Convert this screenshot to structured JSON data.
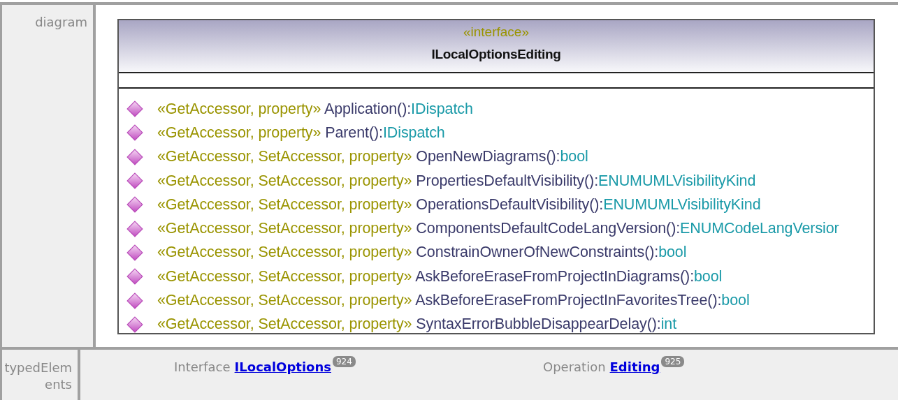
{
  "diagram_row": {
    "label": "diagram",
    "interface": {
      "stereotype": "«interface»",
      "name": "ILocalOptionsEditing",
      "operations": [
        {
          "stereotype": "«GetAccessor, property»",
          "name": "Application():",
          "type": "IDispatch"
        },
        {
          "stereotype": "«GetAccessor, property»",
          "name": "Parent():",
          "type": "IDispatch"
        },
        {
          "stereotype": "«GetAccessor, SetAccessor, property»",
          "name": "OpenNewDiagrams():",
          "type": "bool"
        },
        {
          "stereotype": "«GetAccessor, SetAccessor, property»",
          "name": "PropertiesDefaultVisibility():",
          "type": "ENUMUMLVisibilityKind"
        },
        {
          "stereotype": "«GetAccessor, SetAccessor, property»",
          "name": "OperationsDefaultVisibility():",
          "type": "ENUMUMLVisibilityKind"
        },
        {
          "stereotype": "«GetAccessor, SetAccessor, property»",
          "name": "ComponentsDefaultCodeLangVersion():",
          "type": "ENUMCodeLangVersior"
        },
        {
          "stereotype": "«GetAccessor, SetAccessor, property»",
          "name": "ConstrainOwnerOfNewConstraints():",
          "type": "bool"
        },
        {
          "stereotype": "«GetAccessor, SetAccessor, property»",
          "name": "AskBeforeEraseFromProjectInDiagrams():",
          "type": "bool"
        },
        {
          "stereotype": "«GetAccessor, SetAccessor, property»",
          "name": "AskBeforeEraseFromProjectInFavoritesTree():",
          "type": "bool"
        },
        {
          "stereotype": "«GetAccessor, SetAccessor, property»",
          "name": "SyntaxErrorBubbleDisappearDelay():",
          "type": "int"
        }
      ]
    }
  },
  "typed_elements_row": {
    "label": "typedElements",
    "items": [
      {
        "kind_label": "Interface",
        "link": "ILocalOptions",
        "badge": "924"
      },
      {
        "kind_label": "Operation",
        "link": "Editing",
        "badge": "925"
      }
    ]
  }
}
